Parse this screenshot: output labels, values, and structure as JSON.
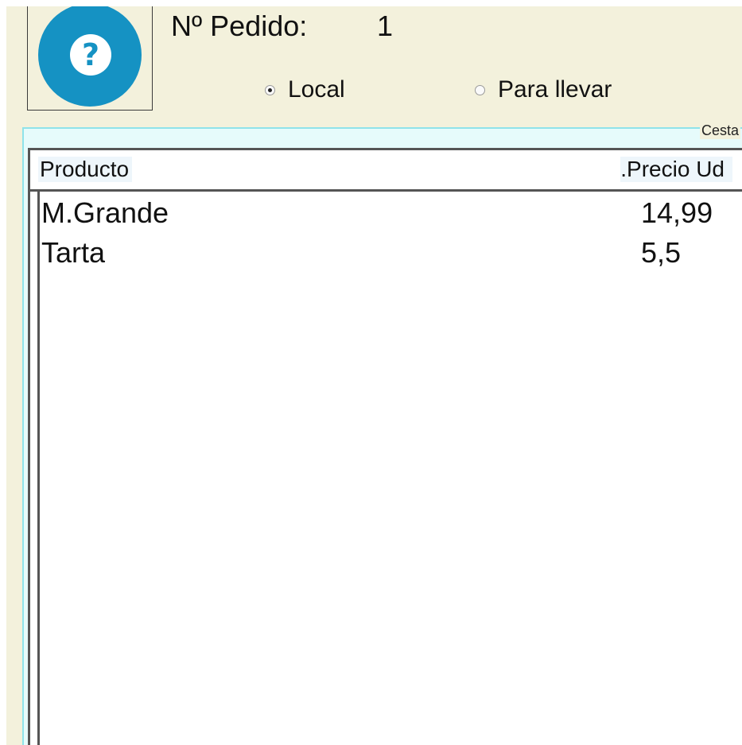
{
  "order": {
    "label": "Nº Pedido:",
    "number": "1"
  },
  "help": {
    "icon": "help-icon",
    "glyph": "?"
  },
  "service_type": {
    "options": [
      {
        "label": "Local",
        "checked": true
      },
      {
        "label": "Para llevar",
        "checked": false
      }
    ]
  },
  "basket": {
    "title": "Cesta",
    "columns": [
      "Producto",
      ".Precio Ud"
    ],
    "rows": [
      {
        "product": "M.Grande",
        "price": "14,99"
      },
      {
        "product": "Tarta",
        "price": "5,5"
      }
    ]
  },
  "colors": {
    "window_bg": "#f3f1dc",
    "accent": "#1592c3",
    "group_border": "#8fe3ea"
  }
}
